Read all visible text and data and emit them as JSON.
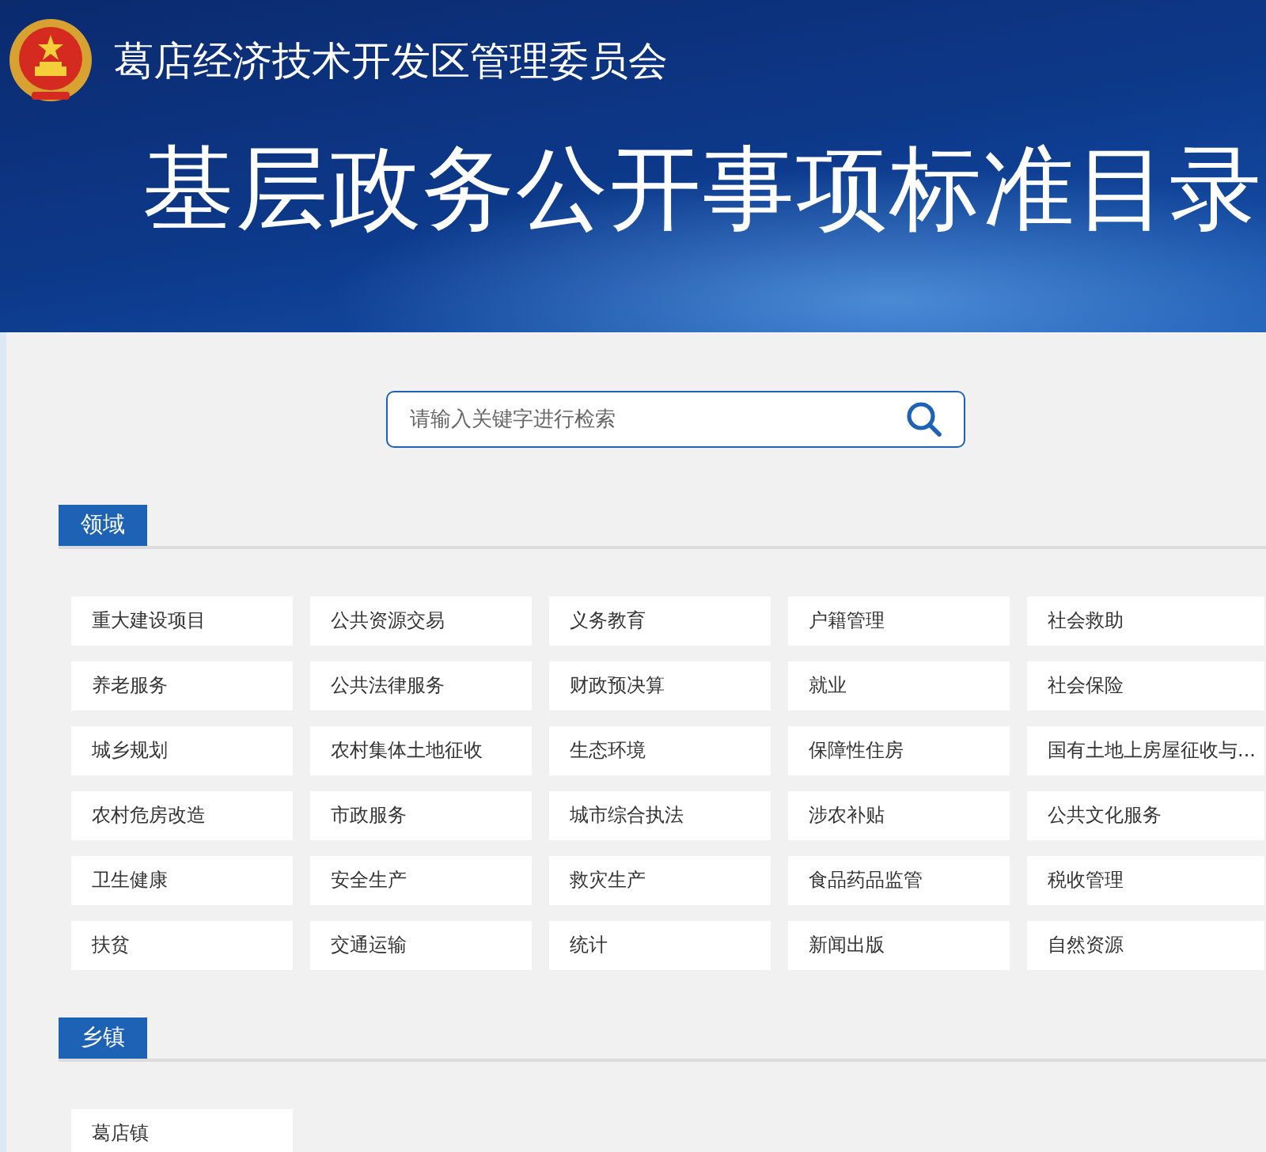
{
  "header": {
    "organization": "葛店经济技术开发区管理委员会",
    "title": "基层政务公开事项标准目录"
  },
  "search": {
    "placeholder": "请输入关键字进行检索"
  },
  "sections": [
    {
      "label": "领域",
      "items": [
        "重大建设项目",
        "公共资源交易",
        "义务教育",
        "户籍管理",
        "社会救助",
        "养老服务",
        "公共法律服务",
        "财政预决算",
        "就业",
        "社会保险",
        "城乡规划",
        "农村集体土地征收",
        "生态环境",
        "保障性住房",
        "国有土地上房屋征收与...",
        "农村危房改造",
        "市政服务",
        "城市综合执法",
        "涉农补贴",
        "公共文化服务",
        "卫生健康",
        "安全生产",
        "救灾生产",
        "食品药品监管",
        "税收管理",
        "扶贫",
        "交通运输",
        "统计",
        "新闻出版",
        "自然资源"
      ]
    },
    {
      "label": "乡镇",
      "items": [
        "葛店镇"
      ]
    }
  ]
}
